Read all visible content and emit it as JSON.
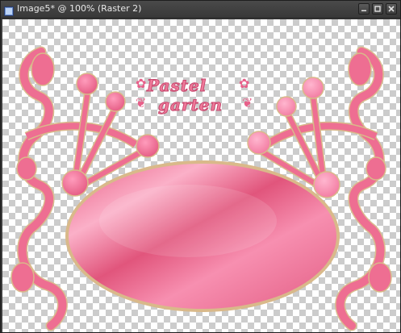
{
  "window": {
    "title": "Image5* @ 100% (Raster 2)",
    "controls": [
      "minimize",
      "maximize",
      "close"
    ]
  },
  "canvas": {
    "background": "transparency-checkerboard",
    "image": {
      "text_line1": "Pastel",
      "text_line2": "garten",
      "colors": {
        "pink": "#ec6f8f",
        "light_pink": "#f799b6",
        "gold_outline": "#d9b98a"
      }
    }
  }
}
